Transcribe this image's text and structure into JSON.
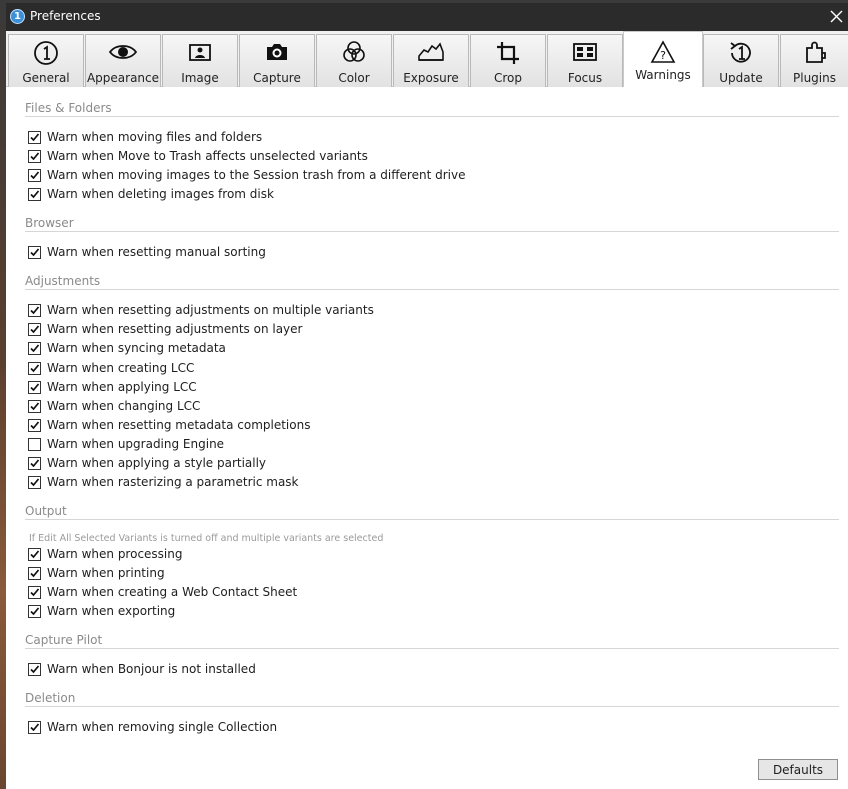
{
  "window": {
    "title": "Preferences"
  },
  "tabs": [
    {
      "label": "General",
      "icon": "one-circle-icon"
    },
    {
      "label": "Appearance",
      "icon": "eye-icon"
    },
    {
      "label": "Image",
      "icon": "image-card-icon"
    },
    {
      "label": "Capture",
      "icon": "camera-icon"
    },
    {
      "label": "Color",
      "icon": "color-circles-icon"
    },
    {
      "label": "Exposure",
      "icon": "histogram-icon"
    },
    {
      "label": "Crop",
      "icon": "crop-icon"
    },
    {
      "label": "Focus",
      "icon": "focus-grid-icon"
    },
    {
      "label": "Warnings",
      "icon": "warning-triangle-icon",
      "active": true
    },
    {
      "label": "Update",
      "icon": "update-icon"
    },
    {
      "label": "Plugins",
      "icon": "puzzle-icon"
    }
  ],
  "sections": [
    {
      "title": "Files & Folders",
      "items": [
        {
          "label": "Warn when moving files and folders",
          "checked": true
        },
        {
          "label": "Warn when Move to Trash affects unselected variants",
          "checked": true
        },
        {
          "label": "Warn when moving images to the Session trash from a different drive",
          "checked": true
        },
        {
          "label": "Warn when deleting images from disk",
          "checked": true
        }
      ]
    },
    {
      "title": "Browser",
      "items": [
        {
          "label": "Warn when resetting manual sorting",
          "checked": true
        }
      ]
    },
    {
      "title": "Adjustments",
      "items": [
        {
          "label": "Warn when resetting adjustments on multiple variants",
          "checked": true
        },
        {
          "label": "Warn when resetting adjustments on layer",
          "checked": true
        },
        {
          "label": "Warn when syncing metadata",
          "checked": true
        },
        {
          "label": "Warn when creating LCC",
          "checked": true
        },
        {
          "label": "Warn when applying LCC",
          "checked": true
        },
        {
          "label": "Warn when changing LCC",
          "checked": true
        },
        {
          "label": "Warn when resetting metadata completions",
          "checked": true
        },
        {
          "label": "Warn when upgrading Engine",
          "checked": false
        },
        {
          "label": "Warn when applying a style partially",
          "checked": true
        },
        {
          "label": "Warn when rasterizing a parametric mask",
          "checked": true
        }
      ]
    },
    {
      "title": "Output",
      "note": "If Edit All Selected Variants is turned off and multiple variants are selected",
      "items": [
        {
          "label": "Warn when processing",
          "checked": true
        },
        {
          "label": "Warn when printing",
          "checked": true
        },
        {
          "label": "Warn when creating a Web Contact Sheet",
          "checked": true
        },
        {
          "label": "Warn when exporting",
          "checked": true
        }
      ]
    },
    {
      "title": "Capture Pilot",
      "items": [
        {
          "label": "Warn when Bonjour is not installed",
          "checked": true
        }
      ]
    },
    {
      "title": "Deletion",
      "items": [
        {
          "label": "Warn when removing single Collection",
          "checked": true
        }
      ]
    }
  ],
  "footer": {
    "defaults_label": "Defaults"
  }
}
